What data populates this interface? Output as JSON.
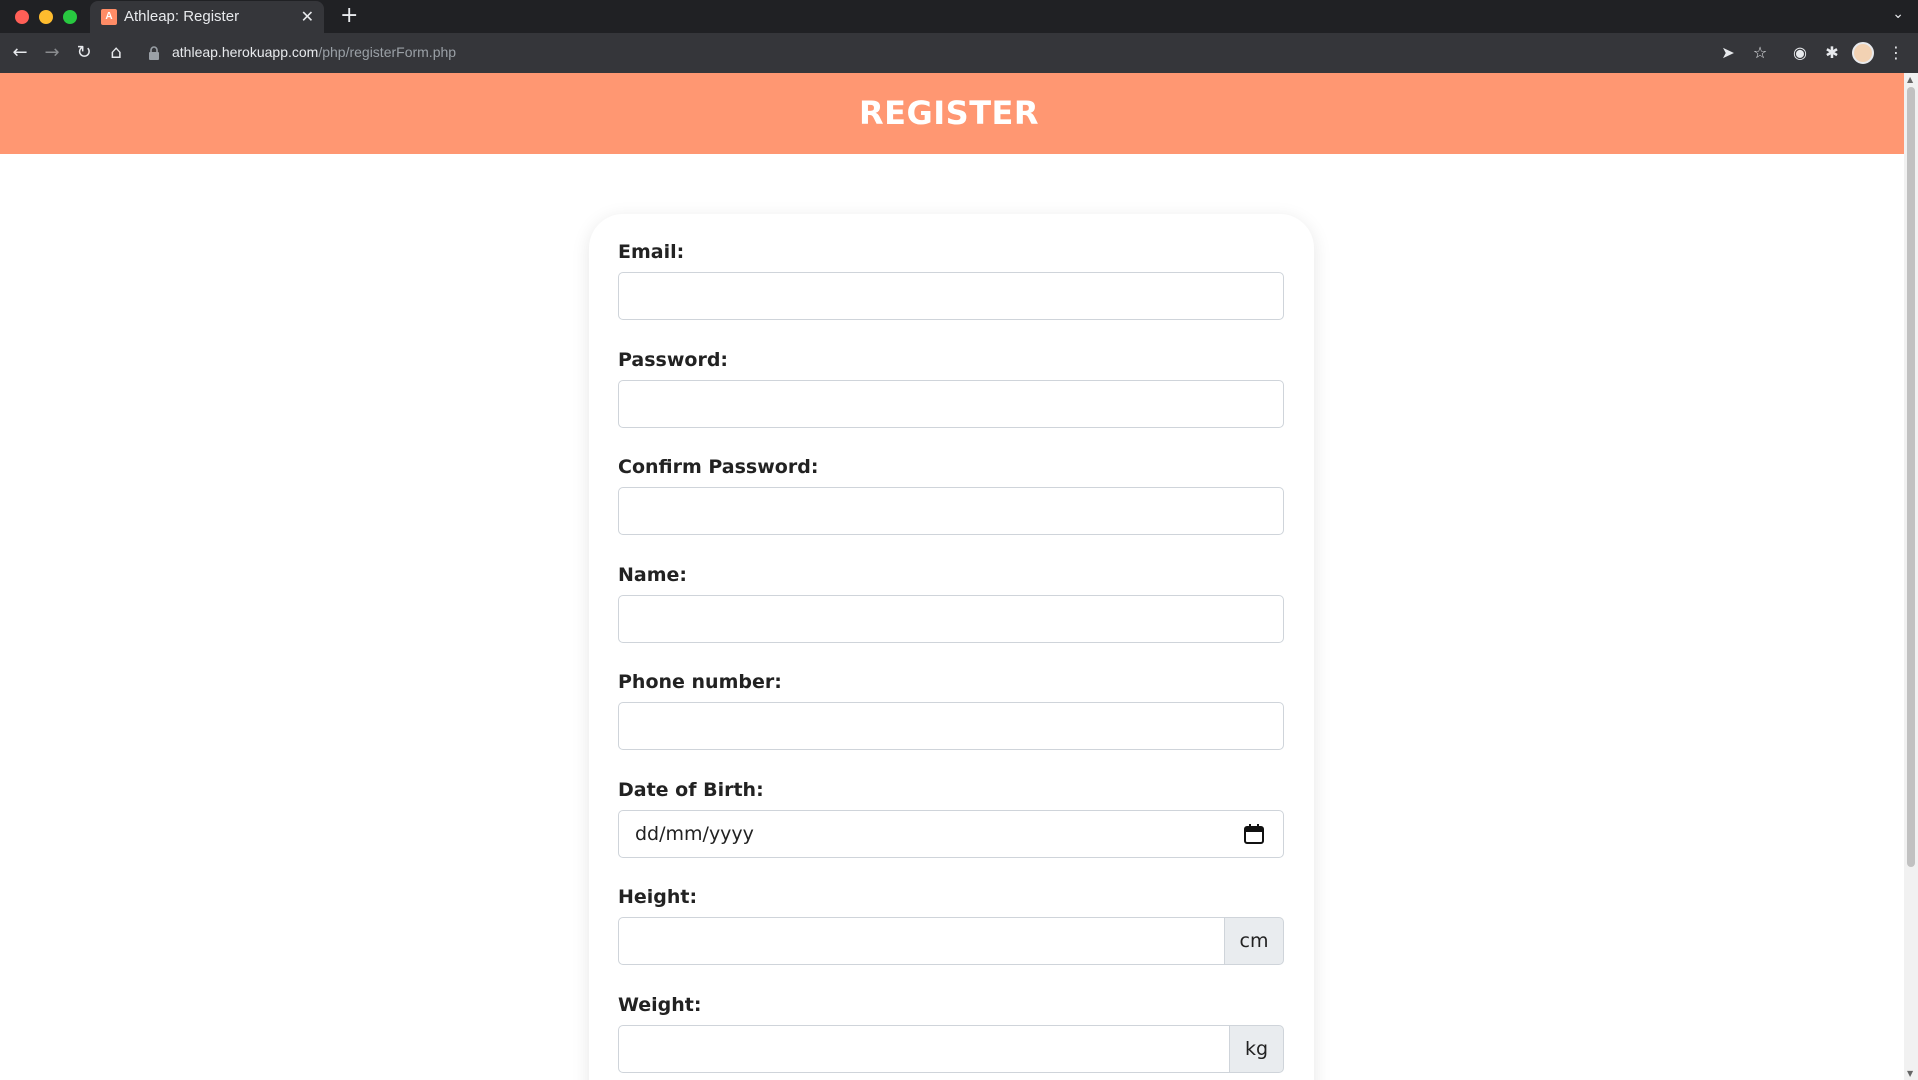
{
  "browser": {
    "tab_title": "Athleap: Register",
    "tab_favicon_letter": "A",
    "url_host": "athleap.herokuapp.com",
    "url_path": "/php/registerForm.php"
  },
  "header": {
    "title": "REGISTER",
    "color": "#ff9772"
  },
  "form": {
    "email_label": "Email:",
    "password_label": "Password:",
    "confirm_password_label": "Confirm Password:",
    "name_label": "Name:",
    "phone_label": "Phone number:",
    "dob_label": "Date of Birth:",
    "dob_placeholder": "dd/mm/yyyy",
    "height_label": "Height:",
    "height_unit": "cm",
    "weight_label": "Weight:",
    "weight_unit": "kg"
  }
}
